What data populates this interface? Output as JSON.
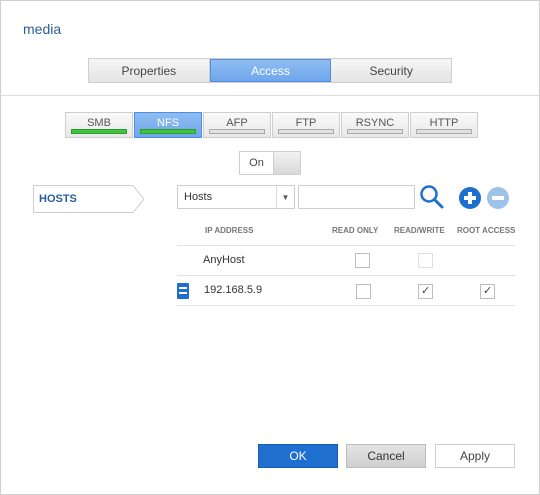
{
  "window": {
    "title": "media"
  },
  "main_tabs": [
    {
      "label": "Properties",
      "active": false
    },
    {
      "label": "Access",
      "active": true
    },
    {
      "label": "Security",
      "active": false
    }
  ],
  "protocol_tabs": [
    {
      "label": "SMB",
      "enabled": true,
      "active": false
    },
    {
      "label": "NFS",
      "enabled": true,
      "active": true
    },
    {
      "label": "AFP",
      "enabled": false,
      "active": false
    },
    {
      "label": "FTP",
      "enabled": false,
      "active": false
    },
    {
      "label": "RSYNC",
      "enabled": false,
      "active": false
    },
    {
      "label": "HTTP",
      "enabled": false,
      "active": false
    }
  ],
  "toggle": {
    "label": "On"
  },
  "hosts_button": {
    "label": "HOSTS"
  },
  "filter": {
    "selected": "Hosts",
    "search_value": ""
  },
  "table": {
    "headers": [
      "IP ADDRESS",
      "READ ONLY",
      "READ/WRITE",
      "ROOT ACCESS"
    ],
    "rows": [
      {
        "host": "AnyHost",
        "read_only": false,
        "read_write": false,
        "root_access": false
      },
      {
        "host": "192.168.5.9",
        "read_only": false,
        "read_write": true,
        "root_access": true
      }
    ]
  },
  "buttons": {
    "ok": "OK",
    "cancel": "Cancel",
    "apply": "Apply"
  },
  "colors": {
    "accent": "#1e6fd0",
    "active_tab": "#7fb2ef",
    "enabled_bar": "#3ec43e",
    "title": "#2a5d9a"
  }
}
